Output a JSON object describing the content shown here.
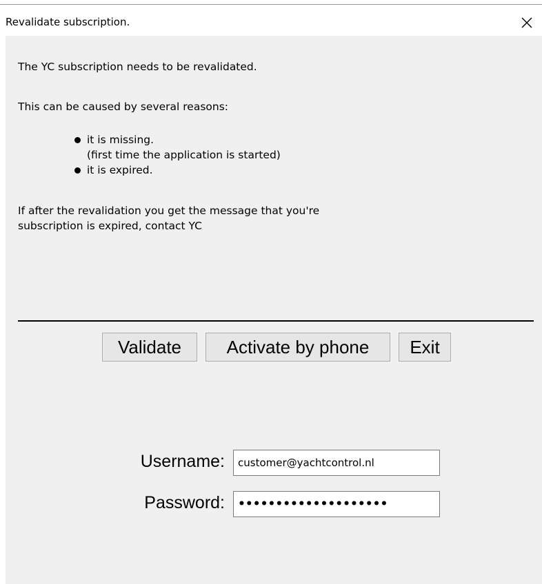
{
  "window": {
    "title": "Revalidate subscription."
  },
  "message": {
    "line1": "The YC subscription needs to be revalidated.",
    "line2": "This can be caused by several reasons:",
    "reasons": [
      {
        "text": "it is missing.",
        "subtext": "(first time the application is started)"
      },
      {
        "text": "it is expired.",
        "subtext": ""
      }
    ],
    "footer_line1": "If after the revalidation you get the message that you're",
    "footer_line2": "subscription is expired, contact YC"
  },
  "buttons": {
    "validate": "Validate",
    "activate_by_phone": "Activate by phone",
    "exit": "Exit"
  },
  "form": {
    "username_label": "Username:",
    "username_value": "customer@yachtcontrol.nl",
    "password_label": "Password:",
    "password_value": "••••••••••••••••••••"
  },
  "icons": {
    "close": "close-icon",
    "bullet": "bullet-icon"
  },
  "colors": {
    "dialog_background": "#f0f0f0",
    "title_background": "#ffffff",
    "button_background": "#e6e6e6",
    "button_border": "#adadad"
  }
}
